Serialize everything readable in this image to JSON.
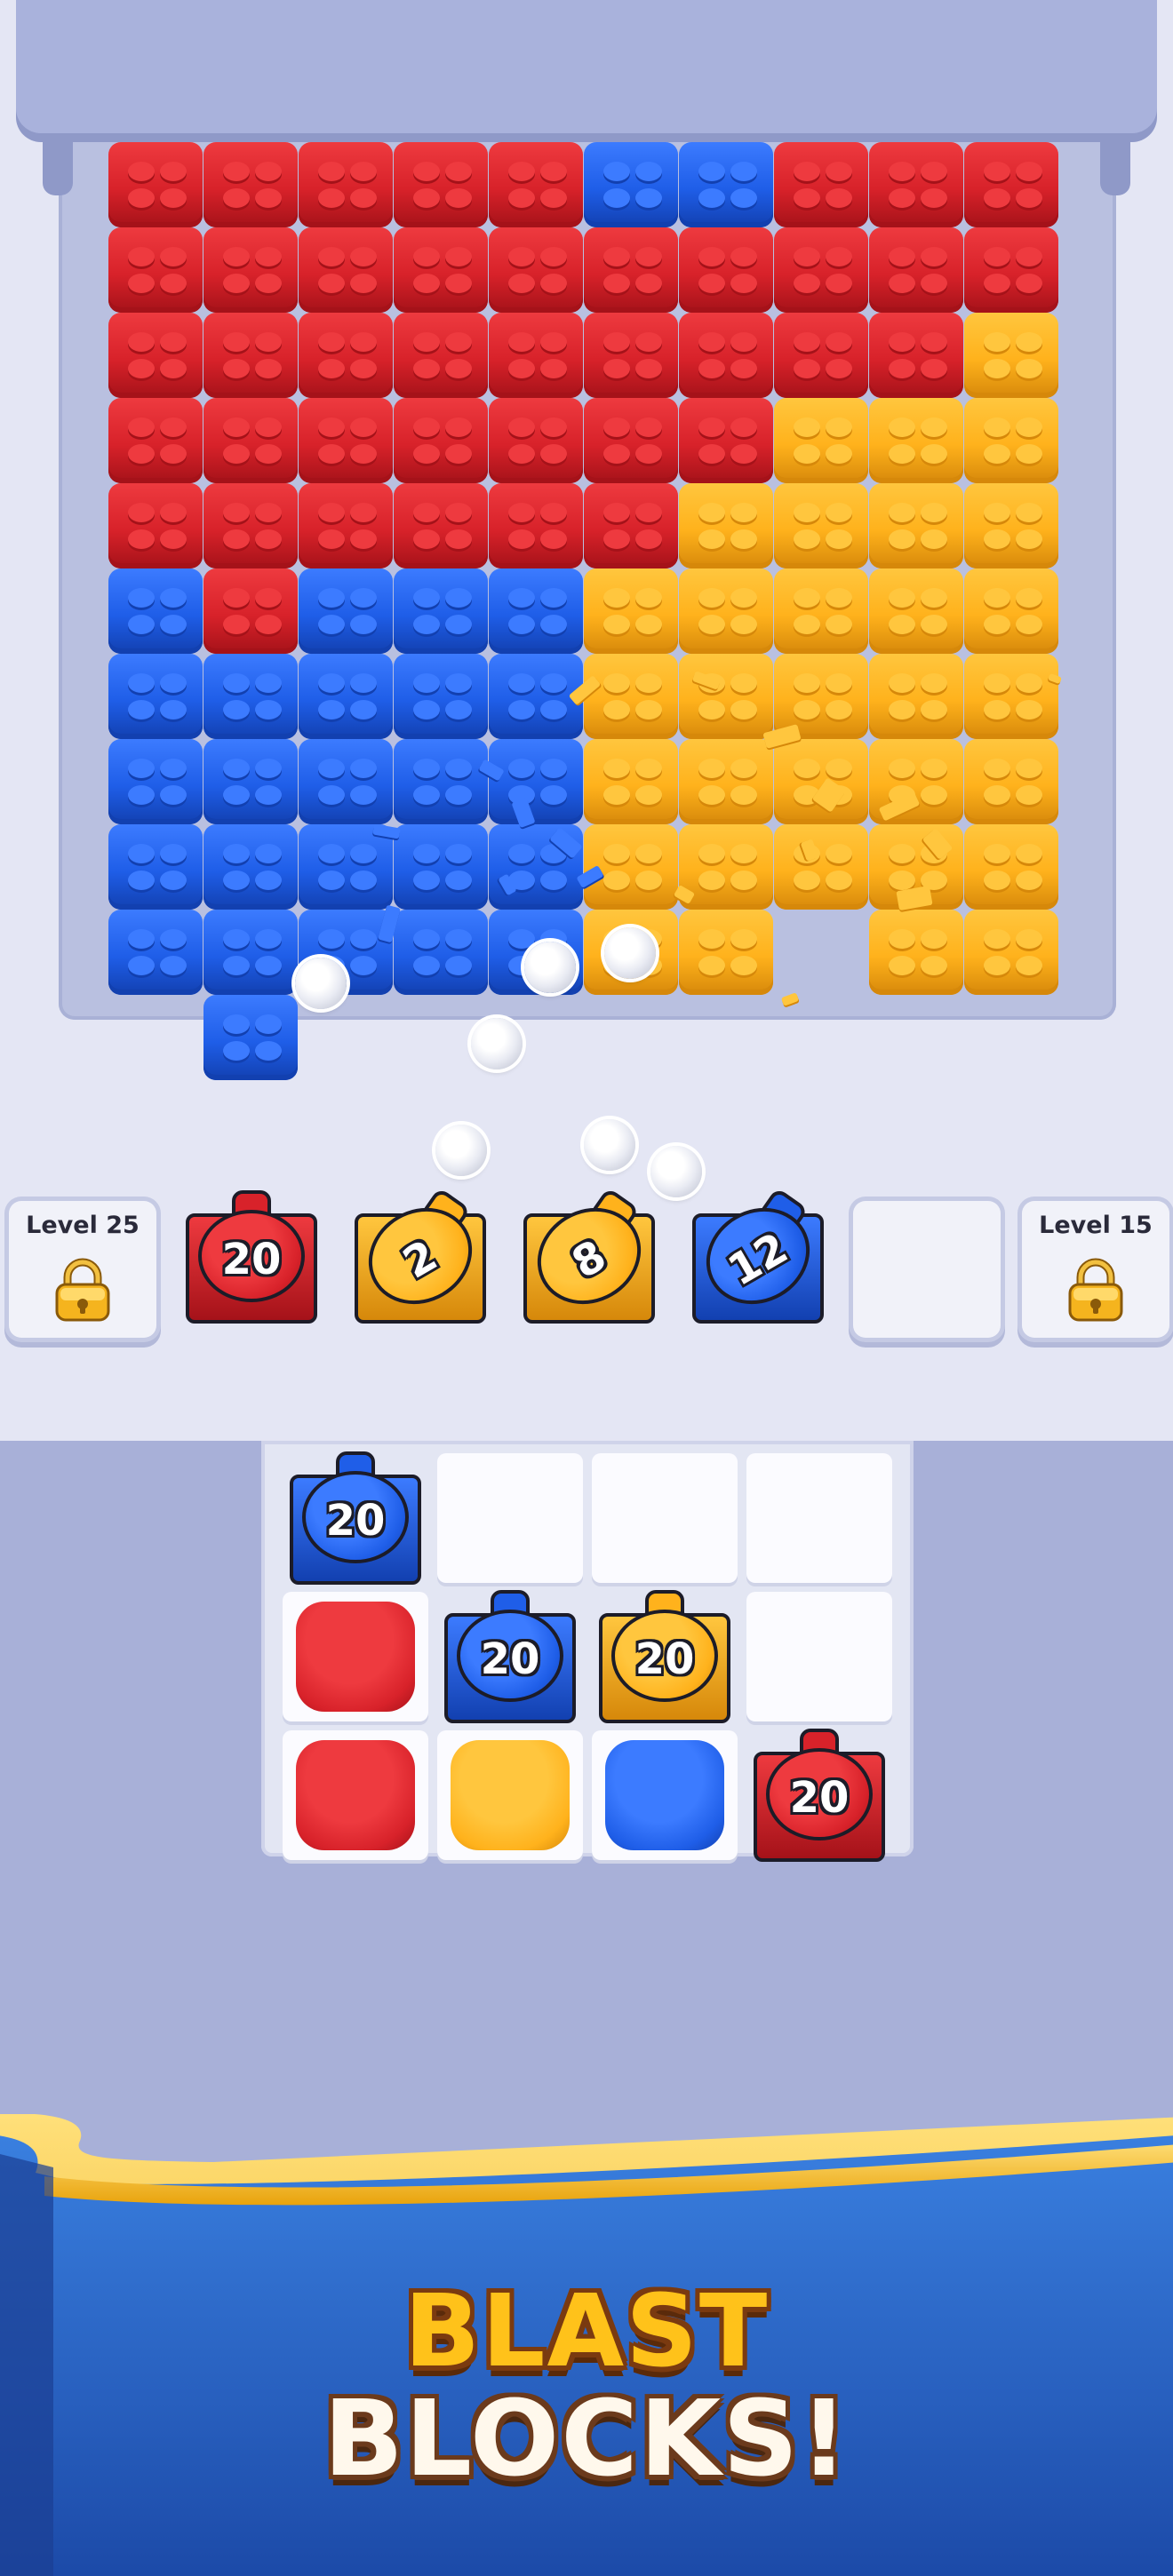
{
  "palette": {
    "red": "#d8222a",
    "red_light": "#ee3a3f",
    "red_dark": "#a51219",
    "blue": "#1f5ee8",
    "blue_light": "#3c7bff",
    "blue_dark": "#1240b0",
    "yellow": "#ffb21c",
    "yellow_light": "#ffc63e",
    "yellow_dark": "#d6880a"
  },
  "block_wall": {
    "columns": [
      {
        "top_color": "yellow",
        "stack": [
          [
            "red",
            5
          ],
          [
            "blue",
            5
          ]
        ]
      },
      {
        "top_color": null,
        "stack": [
          [
            "red",
            6
          ],
          [
            "blue",
            5
          ]
        ]
      },
      {
        "top_color": null,
        "stack": [
          [
            "red",
            5
          ],
          [
            "blue",
            5
          ]
        ]
      },
      {
        "top_color": null,
        "stack": [
          [
            "red",
            5
          ],
          [
            "blue",
            5
          ]
        ]
      },
      {
        "top_color": null,
        "stack": [
          [
            "red",
            5
          ],
          [
            "blue",
            5
          ]
        ]
      },
      {
        "top_color": null,
        "stack": [
          [
            "blue",
            1
          ],
          [
            "red",
            4
          ],
          [
            "yellow",
            5
          ]
        ]
      },
      {
        "top_color": null,
        "stack": [
          [
            "blue",
            1
          ],
          [
            "red",
            3
          ],
          [
            "yellow",
            6
          ]
        ]
      },
      {
        "top_color": null,
        "stack": [
          [
            "red",
            3
          ],
          [
            "yellow",
            6
          ]
        ]
      },
      {
        "top_color": null,
        "stack": [
          [
            "red",
            3
          ],
          [
            "yellow",
            7
          ]
        ]
      },
      {
        "top_color": null,
        "stack": [
          [
            "red",
            2
          ],
          [
            "yellow",
            8
          ]
        ]
      }
    ]
  },
  "shooter_slots": [
    {
      "type": "locked",
      "label": "Level 25"
    },
    {
      "type": "shooter",
      "color": "red",
      "count": "20",
      "style": "upright"
    },
    {
      "type": "shooter",
      "color": "yellow",
      "count": "2",
      "style": "tilted"
    },
    {
      "type": "shooter",
      "color": "yellow",
      "count": "8",
      "style": "tilted"
    },
    {
      "type": "shooter",
      "color": "blue",
      "count": "12",
      "style": "tilted"
    },
    {
      "type": "empty"
    },
    {
      "type": "locked",
      "label": "Level 15"
    }
  ],
  "grid": {
    "rows": [
      [
        {
          "kind": "shooter",
          "color": "blue",
          "count": "20"
        },
        {
          "kind": "empty"
        },
        {
          "kind": "empty"
        },
        {
          "kind": "empty"
        }
      ],
      [
        {
          "kind": "pad",
          "color": "red"
        },
        {
          "kind": "shooter",
          "color": "blue",
          "count": "20"
        },
        {
          "kind": "shooter",
          "color": "yellow",
          "count": "20"
        },
        {
          "kind": "empty"
        }
      ],
      [
        {
          "kind": "pad",
          "color": "red"
        },
        {
          "kind": "pad",
          "color": "yellow"
        },
        {
          "kind": "pad",
          "color": "blue"
        },
        {
          "kind": "shooter",
          "color": "red",
          "count": "20"
        }
      ]
    ]
  },
  "banner": {
    "line1": "BLAST",
    "line2": "BLOCKS!",
    "colors": {
      "blue": "#2f6fd6",
      "gold": "#ffc21a"
    }
  }
}
